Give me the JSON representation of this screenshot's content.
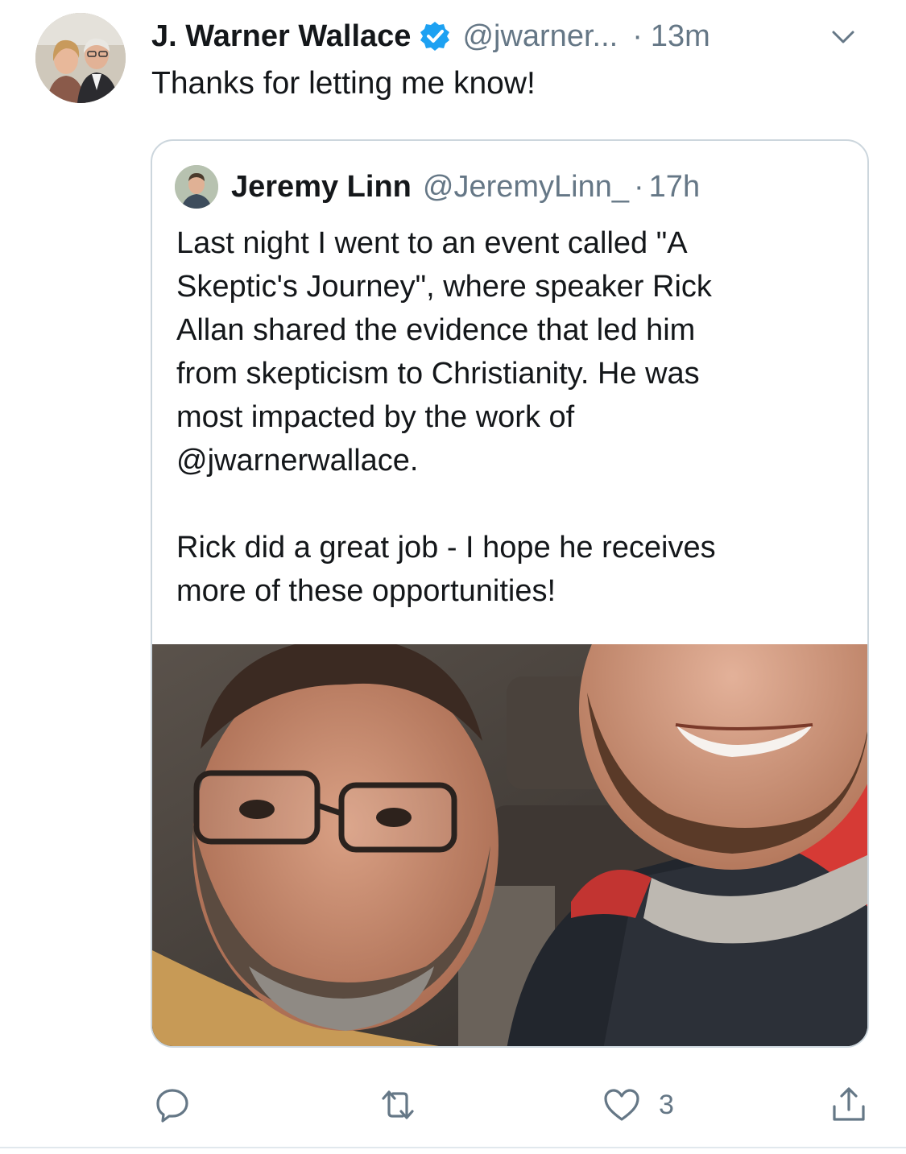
{
  "tweet": {
    "author_name": "J. Warner Wallace",
    "author_handle": "@jwarner...",
    "separator": "·",
    "time": "13m",
    "text": "Thanks for letting me know!",
    "like_count": "3"
  },
  "quoted": {
    "author_name": "Jeremy Linn",
    "author_handle": "@JeremyLinn_",
    "separator": "·",
    "time": "17h",
    "paragraph_1": "Last night I went to an event called \"A\nSkeptic's Journey\", where speaker Rick\nAllan shared the evidence that led him\nfrom skepticism to Christianity. He was\nmost impacted by the work of\n@jwarnerwallace.",
    "paragraph_2": "Rick did a great job - I hope he receives\nmore of these opportunities!"
  },
  "icons": {
    "verified": "verified-badge-icon",
    "menu": "chevron-down-icon",
    "reply": "reply-icon",
    "retweet": "retweet-icon",
    "like": "heart-icon",
    "share": "share-icon"
  },
  "colors": {
    "verified_blue": "#1da1f2",
    "secondary_text": "#657786",
    "primary_text": "#14171a",
    "border": "#ccd6dd"
  }
}
